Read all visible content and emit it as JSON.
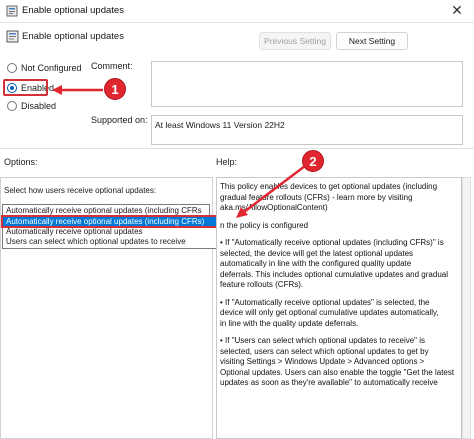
{
  "window": {
    "title": "Enable optional updates",
    "close_glyph": "✕"
  },
  "header": {
    "policy_name": "Enable optional updates"
  },
  "toolbar": {
    "prev_label": "Previous Setting",
    "next_label": "Next Setting"
  },
  "radio_options": [
    {
      "label": "Not Configured",
      "checked": false
    },
    {
      "label": "Enabled",
      "checked": true
    },
    {
      "label": "Disabled",
      "checked": false
    }
  ],
  "labels": {
    "comment": "Comment:",
    "supported_on": "Supported on:",
    "options": "Options:",
    "help": "Help:"
  },
  "supported_on_value": "At least Windows 11 Version 22H2",
  "options": {
    "prompt": "Select how users receive optional updates:",
    "selected_value": "Automatically receive optional updates (including CFRs",
    "dropdown_items": [
      "Automatically receive optional updates (including CFRs)",
      "Automatically receive optional updates",
      "Users can select which optional updates to receive"
    ]
  },
  "help_paragraphs": [
    "This policy enables devices to get optional updates (including\ngradual feature rollouts (CFRs) - learn more by visiting\naka.ms/AllowOptionalContent)",
    "n the policy is configured",
    "• If \"Automatically receive optional updates (including CFRs)\" is\nselected, the device will get the latest optional updates\nautomatically in line with the configured quality update\ndeferrals. This includes optional cumulative updates and gradual\nfeature rollouts (CFRs).",
    "• If \"Automatically receive optional updates\" is selected, the\ndevice will only get optional cumulative updates automatically,\nin line with the quality update deferrals.",
    "• If \"Users can select which optional updates to receive\" is\nselected, users can select which optional updates to get by\nvisiting Settings > Windows Update > Advanced options >\nOptional updates. Users can also enable the toggle \"Get the latest\nupdates as soon as they're available\" to automatically receive"
  ],
  "annotations": {
    "step1": "1",
    "step2": "2"
  },
  "colors": {
    "accent": "#0078d7",
    "annotation_red": "#e0262f"
  }
}
